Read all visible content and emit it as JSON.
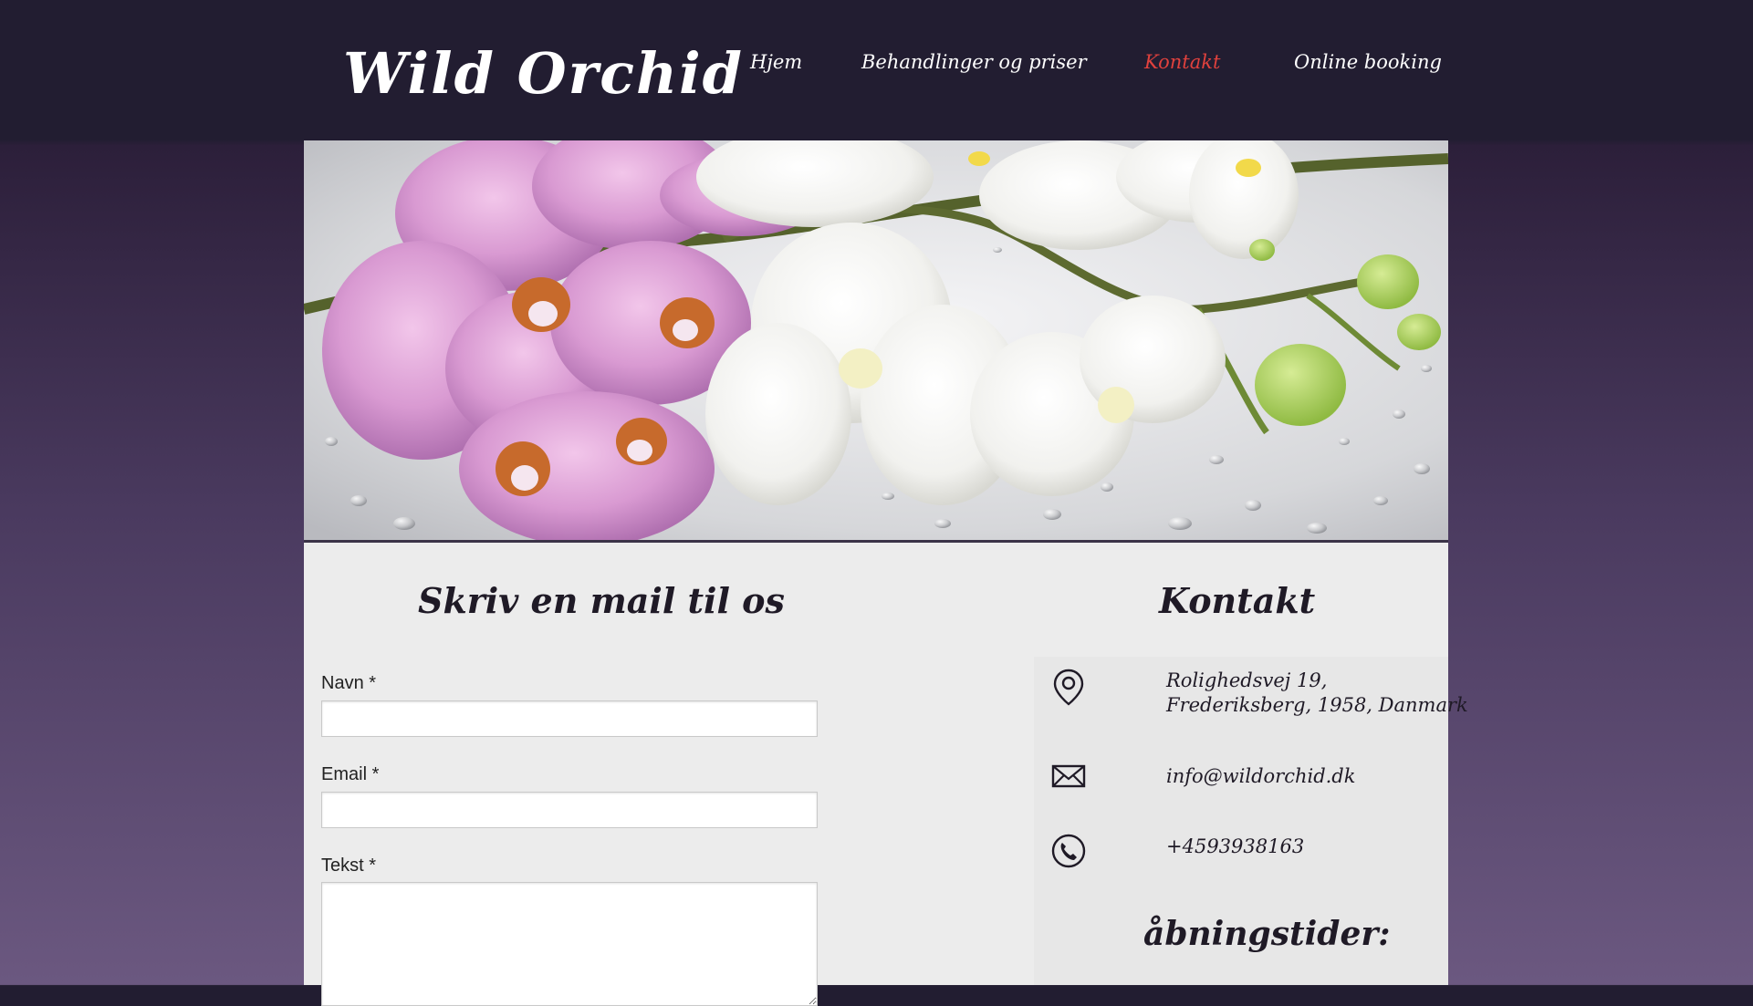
{
  "site": {
    "logo": "Wild Orchid"
  },
  "nav": {
    "items": [
      {
        "label": "Hjem"
      },
      {
        "label": "Behandlinger og priser"
      },
      {
        "label": "Kontakt",
        "active": true
      },
      {
        "label": "Online booking"
      }
    ]
  },
  "form": {
    "title": "Skriv en mail til os",
    "name_label": "Navn *",
    "email_label": "Email *",
    "text_label": "Tekst *",
    "name_value": "",
    "email_value": "",
    "text_value": ""
  },
  "contact": {
    "title": "Kontakt",
    "address_line1": "Rolighedsvej 19,",
    "address_line2": "Frederiksberg, 1958, Danmark",
    "email": "info@wildorchid.dk",
    "phone": "+4593938163",
    "hours_title": "åbningstider:"
  },
  "colors": {
    "header_bg": "#221d31",
    "nav_active": "#e0413d",
    "panel_bg": "#ececec",
    "text_dark": "#1f1a26"
  },
  "icons": [
    "map-pin-icon",
    "envelope-icon",
    "phone-icon"
  ]
}
